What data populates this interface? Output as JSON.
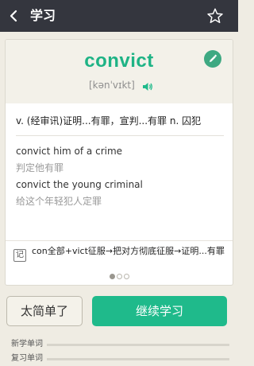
{
  "header": {
    "back_icon": "chevron-left-icon",
    "title": "学习",
    "star_icon": "star-outline-icon"
  },
  "card": {
    "word": "convict",
    "phonetic": "[kənˈvɪkt]",
    "edit_icon": "pencil-icon",
    "speaker_icon": "speaker-icon",
    "meaning": "v. (经审讯)证明...有罪，宣判...有罪  n. 囚犯",
    "examples": [
      {
        "en": "convict him of a crime",
        "zh": "判定他有罪"
      },
      {
        "en": "convict the young criminal",
        "zh": "给这个年轻犯人定罪"
      }
    ],
    "etymology_icon": "memory-note-icon",
    "etymology_icon_text": "记",
    "etymology": "con全部+vict征服→把对方彻底征服→证明...有罪",
    "pager": {
      "pages": 3,
      "current": 1
    }
  },
  "buttons": {
    "too_easy": "太简单了",
    "continue": "继续学习"
  },
  "progress": [
    {
      "label": "新学单词",
      "value": 0.0
    },
    {
      "label": "复习单词",
      "value": 0.0
    }
  ],
  "colors": {
    "accent": "#1fba8b",
    "header_bg": "#34363e",
    "page_bg": "#efece3"
  }
}
